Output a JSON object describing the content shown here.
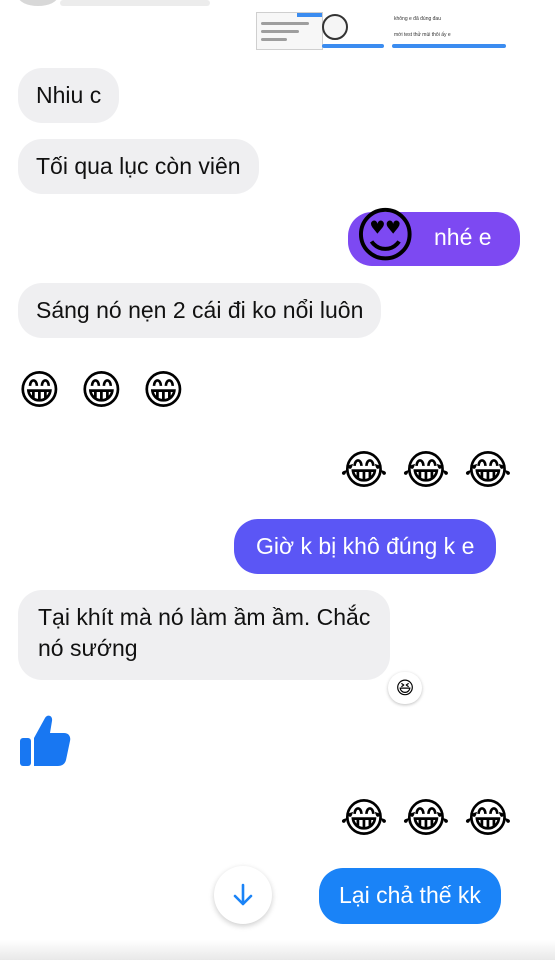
{
  "colors": {
    "incoming_bubble": "#efeff1",
    "outgoing_purple": "#7d49f2",
    "outgoing_indigo": "#5b56f5",
    "outgoing_blue": "#1a83f7",
    "like_blue": "#1877f2"
  },
  "top_preview": {
    "quote_line_1": "không e đã đúng đau",
    "quote_line_2": "mới test thử mùi thôi ấy e"
  },
  "messages": [
    {
      "text": "Nhiu c"
    },
    {
      "text": "Tối qua lục còn viên"
    },
    {
      "text": "nhé e",
      "emoji": "😍"
    },
    {
      "text": "Sáng nó nẹn 2 cái đi ko nổi luôn"
    },
    {
      "emojis": [
        "😁",
        "😁",
        "😁"
      ]
    },
    {
      "emojis": [
        "😂",
        "😂",
        "😂"
      ]
    },
    {
      "text": "Giờ k bị khô đúng k e"
    },
    {
      "line1": "Tại khít mà nó làm ầm ầm. Chắc",
      "line2": "nó sướng",
      "reaction": "😆"
    },
    {
      "icon": "thumbs-up-icon"
    },
    {
      "emojis": [
        "😂",
        "😂",
        "😂"
      ]
    },
    {
      "text": "Lại chả thế kk"
    }
  ]
}
